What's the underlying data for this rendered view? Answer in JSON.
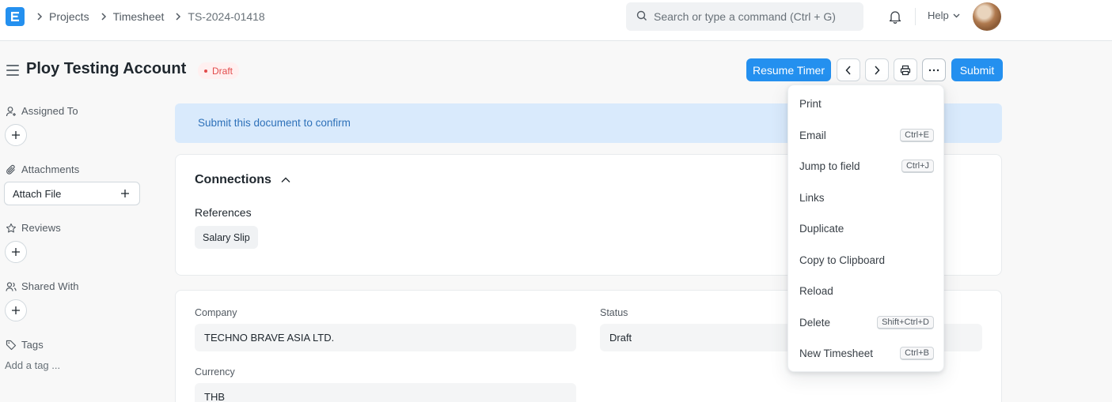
{
  "navbar": {
    "logo_letter": "E",
    "breadcrumbs": [
      "Projects",
      "Timesheet",
      "TS-2024-01418"
    ],
    "search_placeholder": "Search or type a command (Ctrl + G)",
    "help_label": "Help"
  },
  "page": {
    "title": "Ploy Testing Account",
    "status": "Draft",
    "buttons": {
      "resume_timer": "Resume Timer",
      "submit": "Submit"
    }
  },
  "sidebar": {
    "assigned_to": "Assigned To",
    "attachments": "Attachments",
    "attach_file": "Attach File",
    "reviews": "Reviews",
    "shared_with": "Shared With",
    "tags": "Tags",
    "add_tag": "Add a tag ..."
  },
  "alert": {
    "message": "Submit this document to confirm"
  },
  "connections": {
    "title": "Connections",
    "references_label": "References",
    "references": [
      "Salary Slip"
    ]
  },
  "form": {
    "company_label": "Company",
    "company_value": "TECHNO BRAVE ASIA LTD.",
    "status_label": "Status",
    "status_value": "Draft",
    "currency_label": "Currency",
    "currency_value": "THB"
  },
  "menu": {
    "items": [
      {
        "label": "Print",
        "shortcut": ""
      },
      {
        "label": "Email",
        "shortcut": "Ctrl+E"
      },
      {
        "label": "Jump to field",
        "shortcut": "Ctrl+J"
      },
      {
        "label": "Links",
        "shortcut": ""
      },
      {
        "label": "Duplicate",
        "shortcut": ""
      },
      {
        "label": "Copy to Clipboard",
        "shortcut": ""
      },
      {
        "label": "Reload",
        "shortcut": ""
      },
      {
        "label": "Delete",
        "shortcut": "Shift+Ctrl+D"
      },
      {
        "label": "New Timesheet",
        "shortcut": "Ctrl+B"
      }
    ]
  },
  "colors": {
    "primary": "#2490ef",
    "draft_red": "#e24c4c",
    "alert_bg": "#d9eafc",
    "alert_text": "#2e71b9"
  },
  "icons": [
    "app-logo-icon",
    "chevron-right-icon",
    "search-icon",
    "bell-icon",
    "chevron-down-icon",
    "hamburger-icon",
    "chevron-left-icon",
    "printer-icon",
    "ellipsis-icon",
    "user-plus-icon",
    "paperclip-icon",
    "star-icon",
    "users-icon",
    "tag-icon",
    "plus-icon",
    "chevron-up-icon"
  ]
}
